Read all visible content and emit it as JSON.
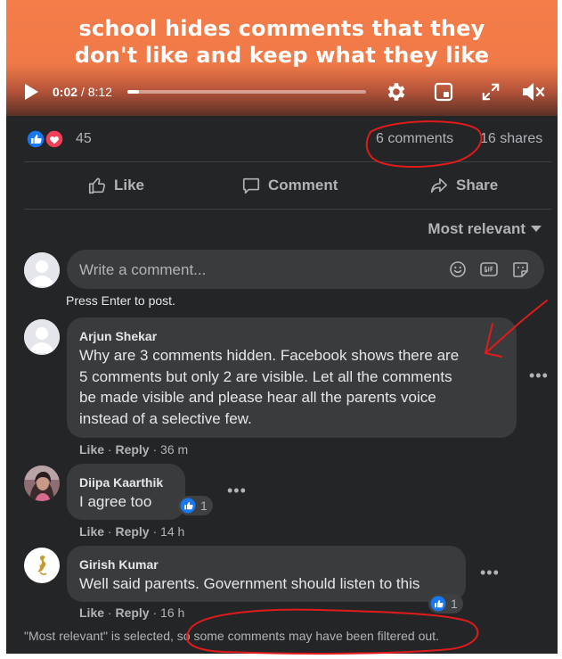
{
  "video": {
    "caption_line1": "school hides comments that they",
    "caption_line2": "don't like and keep what they like",
    "time_current": "0:02",
    "time_separator": " / 8:12",
    "progress_fraction": 0.02
  },
  "stats": {
    "reaction_icons": [
      "like-icon",
      "love-icon"
    ],
    "reaction_count": "45",
    "comments": "6 comments",
    "shares": "16 shares"
  },
  "actions": {
    "like": "Like",
    "comment": "Comment",
    "share": "Share"
  },
  "sort": {
    "label": "Most relevant"
  },
  "composer": {
    "placeholder": "Write a comment...",
    "hint": "Press Enter to post.",
    "icons": [
      "emoji-icon",
      "gif-icon",
      "sticker-icon"
    ]
  },
  "comments": [
    {
      "author": "Arjun Shekar",
      "lines": [
        "Why are 3 comments hidden. Facebook shows there are",
        "5 comments but only 2 are visible. Let all the comments",
        "be made visible and please hear all the parents voice",
        "instead of a selective few."
      ],
      "like": "Like",
      "reply": "Reply",
      "time": "36 m"
    },
    {
      "author": "Diipa Kaarthik",
      "text": "I agree too",
      "reactions": "1",
      "like": "Like",
      "reply": "Reply",
      "time": "14 h"
    },
    {
      "author": "Girish Kumar",
      "text": "Well said parents. Government should listen to this",
      "reactions": "1",
      "like": "Like",
      "reply": "Reply",
      "time": "16 h"
    }
  ],
  "footer": {
    "note": "\"Most relevant\" is selected, so some comments may have been filtered out."
  },
  "colors": {
    "panel": "#242526",
    "bubble": "#3a3b3c",
    "text_primary": "#e4e6eb",
    "text_secondary": "#b0b3b8",
    "like_blue": "#1877f2",
    "love_red": "#f33e58",
    "annotation_red": "#e11b1b",
    "banner_orange": "#f47d4a"
  }
}
